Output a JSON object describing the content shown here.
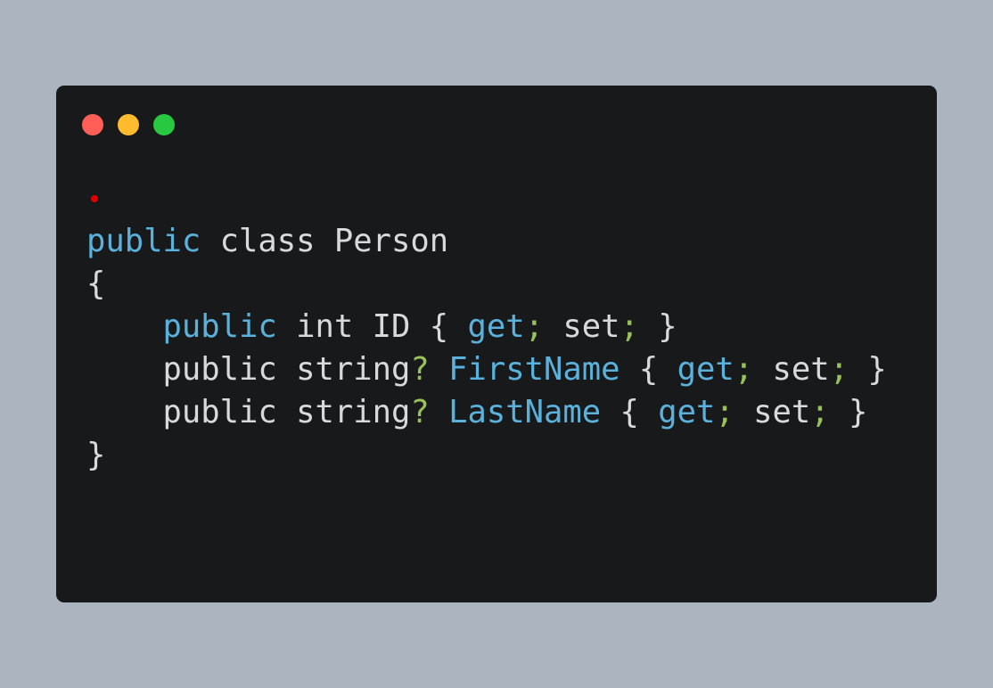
{
  "window": {
    "buttons": {
      "close_color": "#ff5f57",
      "minimize_color": "#febc2e",
      "maximize_color": "#28c840"
    }
  },
  "code": {
    "lines": [
      [
        {
          "text": "public",
          "kind": "keyword"
        },
        {
          "text": " class Person",
          "kind": "plain"
        }
      ],
      [
        {
          "text": "{",
          "kind": "plain"
        }
      ],
      [
        {
          "text": "    ",
          "kind": "plain"
        },
        {
          "text": "public",
          "kind": "keyword"
        },
        {
          "text": " int ID { ",
          "kind": "plain"
        },
        {
          "text": "get",
          "kind": "keyword"
        },
        {
          "text": ";",
          "kind": "punct"
        },
        {
          "text": " set",
          "kind": "plain"
        },
        {
          "text": ";",
          "kind": "punct"
        },
        {
          "text": " }",
          "kind": "plain"
        }
      ],
      [
        {
          "text": "    public string",
          "kind": "plain"
        },
        {
          "text": "?",
          "kind": "punct"
        },
        {
          "text": " ",
          "kind": "plain"
        },
        {
          "text": "FirstName",
          "kind": "keyword"
        },
        {
          "text": " { ",
          "kind": "plain"
        },
        {
          "text": "get",
          "kind": "keyword"
        },
        {
          "text": ";",
          "kind": "punct"
        },
        {
          "text": " set",
          "kind": "plain"
        },
        {
          "text": ";",
          "kind": "punct"
        },
        {
          "text": " }",
          "kind": "plain"
        }
      ],
      [
        {
          "text": "    public string",
          "kind": "plain"
        },
        {
          "text": "?",
          "kind": "punct"
        },
        {
          "text": " ",
          "kind": "plain"
        },
        {
          "text": "LastName",
          "kind": "keyword"
        },
        {
          "text": " { ",
          "kind": "plain"
        },
        {
          "text": "get",
          "kind": "keyword"
        },
        {
          "text": ";",
          "kind": "punct"
        },
        {
          "text": " set",
          "kind": "plain"
        },
        {
          "text": ";",
          "kind": "punct"
        },
        {
          "text": " }",
          "kind": "plain"
        }
      ],
      [
        {
          "text": "}",
          "kind": "plain"
        }
      ]
    ],
    "colors": {
      "keyword": "#5ab2dc",
      "plain": "#d8d9da",
      "punct": "#98c15a"
    }
  }
}
